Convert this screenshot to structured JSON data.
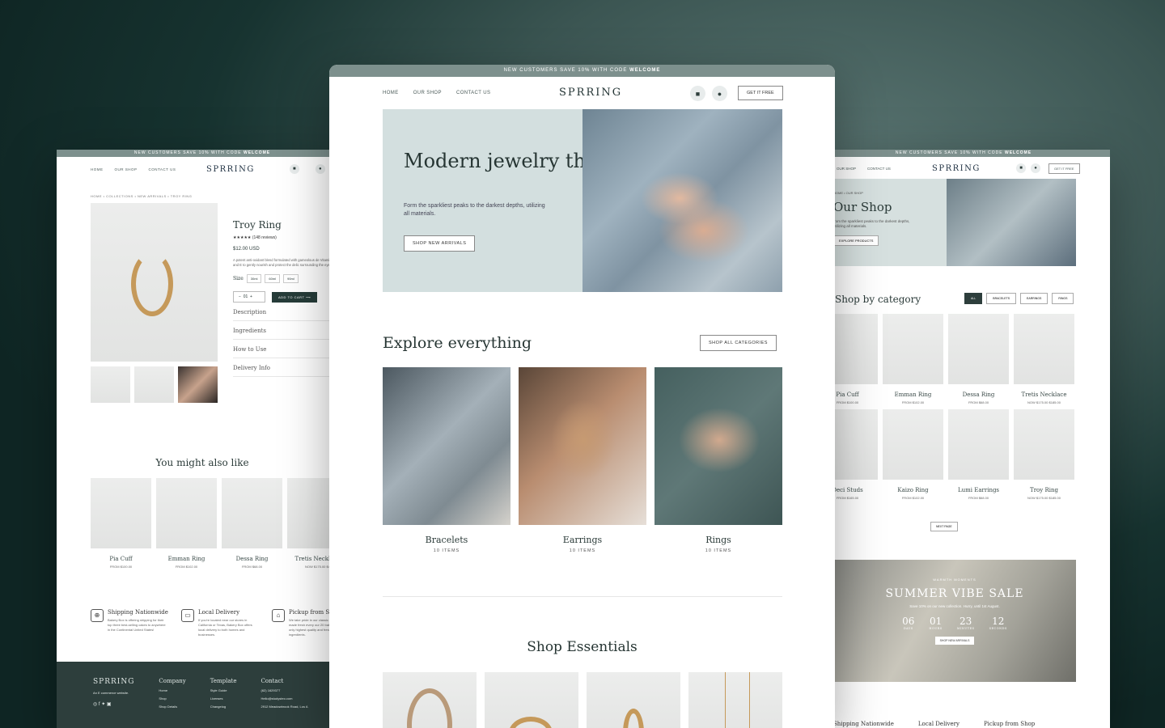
{
  "colors": {
    "accent": "#2d3e3c",
    "promo": "#7d908d",
    "hero": "#d3dfdf"
  },
  "promo": {
    "text_prefix": "NEW CUSTOMERS SAVE 10% WITH CODE ",
    "code": "WELCOME"
  },
  "brand": "SPRRING",
  "center": {
    "nav": {
      "home": "HOME",
      "shop": "OUR SHOP",
      "contact": "CONTACT US",
      "cta": "GET IT FREE",
      "cart_icon": "cart-icon",
      "user_icon": "user-icon"
    },
    "hero": {
      "title": "Modern jewelry that lasts.",
      "subtitle": "Form the sparkliest peaks to the darkest depths, utilizing all materials.",
      "cta": "SHOP NEW ARRIVALS"
    },
    "explore": {
      "title": "Explore everything",
      "cta": "SHOP ALL CATEGORIES",
      "categories": [
        {
          "name": "Bracelets",
          "count": "10 ITEMS"
        },
        {
          "name": "Earrings",
          "count": "10 ITEMS"
        },
        {
          "name": "Rings",
          "count": "10 ITEMS"
        }
      ]
    },
    "essentials": {
      "title": "Shop Essentials"
    }
  },
  "left": {
    "nav": {
      "home": "HOME",
      "shop": "OUR SHOP",
      "contact": "CONTACT US"
    },
    "breadcrumb": "HOME • COLLECTIONS • NEW ARRIVALS • TROY RING",
    "product": {
      "title": "Troy Ring",
      "stars": "★★★★★",
      "reviews": "(148 reviews)",
      "price": "$12.00 USD",
      "description": "A potent anti-oxidant blend formulated with gameolous de Vitamins C and E to gently nourish and protect the delic surrounding the eyes.",
      "size_label": "Size",
      "sizes": [
        "30ml",
        "60ml",
        "90ml"
      ],
      "qty": "01",
      "add_to_cart": "ADD TO CART",
      "accordion": [
        "Description",
        "Ingredients",
        "How to Use",
        "Delivery Info"
      ]
    },
    "also": {
      "title": "You might also like",
      "items": [
        {
          "name": "Pia Cuff",
          "price": "FROM $100.00"
        },
        {
          "name": "Emman Ring",
          "price": "FROM $102.00"
        },
        {
          "name": "Dessa Ring",
          "price": "FROM $68.00"
        },
        {
          "name": "Tretis Necklace",
          "price": "NOW $175.00 $4"
        }
      ]
    },
    "features": [
      {
        "title": "Shipping Nationwide",
        "text": "Bakery Box is offering shipping for their top three best-selling cakes to anywhere in the Continental United States!"
      },
      {
        "title": "Local Delivery",
        "text": "If you're located near our stores in California or Texas, Bakery Box offers local delivery to both homes and businesses."
      },
      {
        "title": "Pickup from Shop",
        "text": "We take pride in our classic which are made fresh every our 20 bakeries using only highest quality and freshest ingredients."
      }
    ],
    "footer": {
      "brand": "SPRRING",
      "tagline": "An E commerce website.",
      "company": {
        "title": "Company",
        "links": [
          "Home",
          "Shop",
          "Shop Details"
        ]
      },
      "template": {
        "title": "Template",
        "links": [
          "Style Guide",
          "Licenses",
          "Changelog"
        ]
      },
      "contact": {
        "title": "Contact",
        "links": [
          "(62) 1629377",
          "Hello@studysteo.com",
          "2912 Meadowbrook Road, Los A"
        ]
      }
    }
  },
  "right": {
    "nav": {
      "shop": "OUR SHOP",
      "contact": "CONTACT US",
      "cta": "GET IT FREE"
    },
    "hero": {
      "crumb": "HOME • OUR SHOP",
      "title": "Our Shop",
      "subtitle": "from the sparkliest peaks to the darkest depths, utilizing all materials.",
      "cta": "EXPLORE PRODUCTS"
    },
    "category": {
      "title": "Shop by category",
      "filters": [
        "ALL",
        "BRACELETS",
        "EARRINGS",
        "RINGS"
      ]
    },
    "grid": [
      {
        "name": "Pia Cuff",
        "price": "FROM $100.00"
      },
      {
        "name": "Emman Ring",
        "price": "FROM $102.00"
      },
      {
        "name": "Dessa Ring",
        "price": "FROM $68.00"
      },
      {
        "name": "Tretis Necklace",
        "price": "NOW $175.00 $185.00"
      },
      {
        "name": "Deci Studs",
        "price": "FROM $165.00"
      },
      {
        "name": "Kaizo Ring",
        "price": "FROM $102.00"
      },
      {
        "name": "Lumi Earrings",
        "price": "FROM $68.00"
      },
      {
        "name": "Troy Ring",
        "price": "NOW $175.00 $185.00"
      }
    ],
    "next": "NEXT PAGE",
    "sale": {
      "eyebrow": "WARMTH MOMENTS",
      "title": "SUMMER VIBE SALE",
      "text": "Save 10% on our new collection. Hurry, until 1st August.",
      "countdown": [
        {
          "v": "06",
          "l": "DAYS"
        },
        {
          "v": "01",
          "l": "HOURS"
        },
        {
          "v": "23",
          "l": "MINUTES"
        },
        {
          "v": "12",
          "l": "SECONDS"
        }
      ],
      "cta": "SHOP NEW ARRIVALS"
    },
    "features": [
      "Shipping Nationwide",
      "Local Delivery",
      "Pickup from Shop"
    ]
  }
}
